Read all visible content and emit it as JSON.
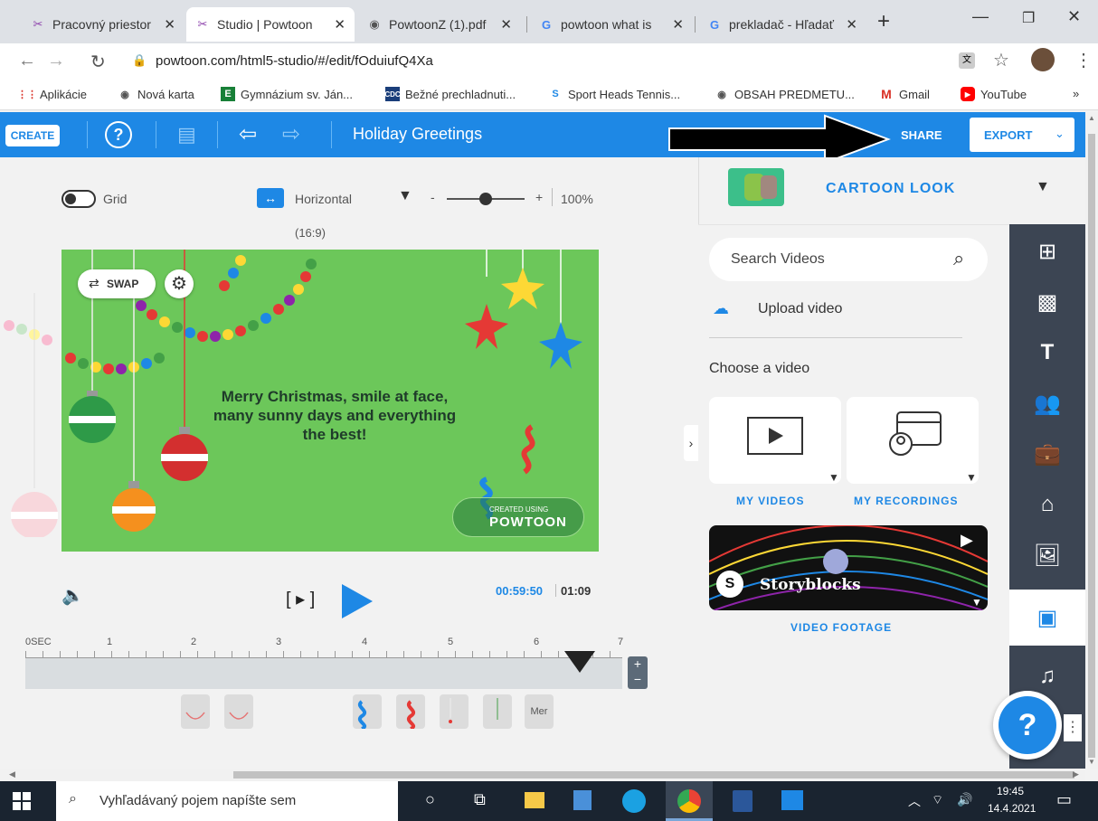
{
  "browser": {
    "tabs": [
      {
        "label": "Pracovný priestor",
        "icon": "powtoon-icon",
        "active": false
      },
      {
        "label": "Studio | Powtoon",
        "icon": "powtoon-icon",
        "active": true
      },
      {
        "label": "PowtoonZ (1).pdf",
        "icon": "globe-icon",
        "active": false
      },
      {
        "label": "powtoon what is",
        "icon": "google-icon",
        "active": false
      },
      {
        "label": "prekladač - Hľadať",
        "icon": "google-icon",
        "active": false
      }
    ],
    "new_tab": "+",
    "url": "powtoon.com/html5-studio/#/edit/fOduiufQ4Xa",
    "bookmarks": [
      "Aplikácie",
      "Nová karta",
      "Gymnázium sv. Ján...",
      "Bežné prechladnuti...",
      "Sport Heads Tennis...",
      "OBSAH PREDMETU...",
      "Gmail",
      "YouTube"
    ],
    "bookmarks_more": "»"
  },
  "header": {
    "create": "CREATE",
    "project_title": "Holiday Greetings",
    "share": "SHARE",
    "export": "EXPORT"
  },
  "stage": {
    "grid_label": "Grid",
    "orientation": "Horizontal",
    "aspect": "(16:9)",
    "zoom": "100%",
    "zoom_minus": "-",
    "zoom_plus": "+",
    "swap": "SWAP",
    "greeting": "Merry Christmas, smile at face, many sunny days and everything the best!",
    "watermark_small": "CREATED USING",
    "watermark_brand": "POWTOON",
    "time_current": "00:59:50",
    "time_total": "01:09",
    "play_scene": "[ ▸ ]",
    "timeline_ticks": [
      "0SEC",
      "1",
      "2",
      "3",
      "4",
      "5",
      "6",
      "7"
    ],
    "thumb_label": "Mer"
  },
  "panel": {
    "style": "CARTOON LOOK",
    "search_placeholder": "Search Videos",
    "upload": "Upload video",
    "choose": "Choose a video",
    "my_videos": "MY VIDEOS",
    "my_recordings": "MY RECORDINGS",
    "storyblocks": "Storyblocks",
    "video_footage": "VIDEO FOOTAGE",
    "help": "?"
  },
  "taskbar": {
    "search_placeholder": "Vyhľadávaný pojem napíšte sem",
    "time": "19:45",
    "date": "14.4.2021"
  },
  "colors": {
    "brand_blue": "#1e88e5",
    "scene_green": "#6cc75a",
    "rail_dark": "#3c4553"
  }
}
